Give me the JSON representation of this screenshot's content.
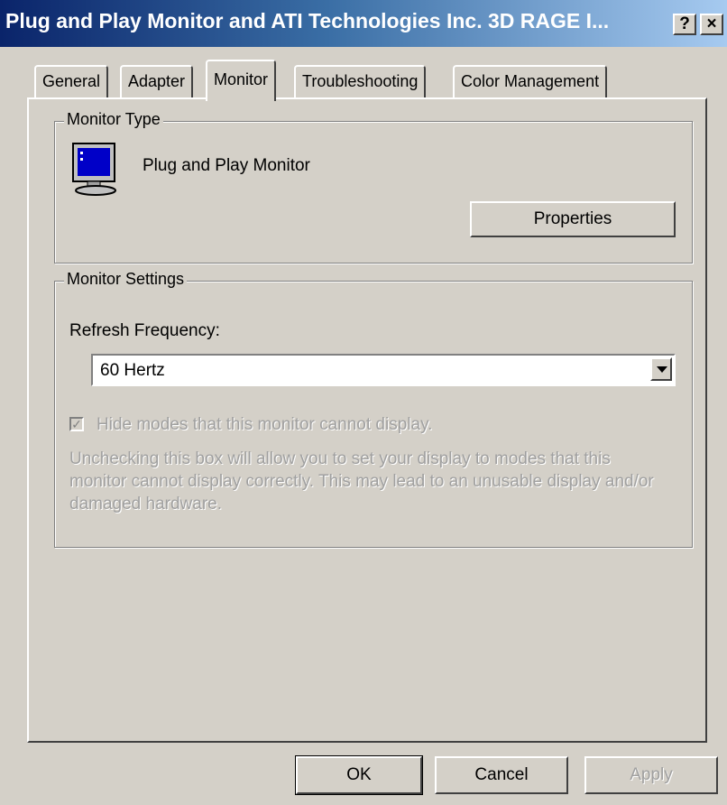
{
  "window": {
    "title": "Plug and Play Monitor and ATI Technologies Inc. 3D RAGE I...",
    "help_label": "?",
    "close_label": "×"
  },
  "tabs": [
    {
      "label": "General",
      "active": false
    },
    {
      "label": "Adapter",
      "active": false
    },
    {
      "label": "Monitor",
      "active": true
    },
    {
      "label": "Troubleshooting",
      "active": false
    },
    {
      "label": "Color Management",
      "active": false
    }
  ],
  "monitor_type": {
    "legend": "Monitor Type",
    "icon": "monitor-icon",
    "name": "Plug and Play Monitor",
    "properties_label": "Properties"
  },
  "monitor_settings": {
    "legend": "Monitor Settings",
    "refresh_label": "Refresh Frequency:",
    "refresh_value": "60 Hertz",
    "hide_modes_label": "Hide modes that this monitor cannot display.",
    "hide_modes_checked": true,
    "warning": "Unchecking this box will allow you to set your display to modes that this monitor cannot display correctly. This may lead to an unusable display and/or damaged hardware."
  },
  "footer": {
    "ok_label": "OK",
    "cancel_label": "Cancel",
    "apply_label": "Apply"
  },
  "colors": {
    "titlebar_start": "#0a246a",
    "titlebar_end": "#a6caf0",
    "face": "#d4d0c8",
    "disabled_text": "#a0a0a0"
  }
}
